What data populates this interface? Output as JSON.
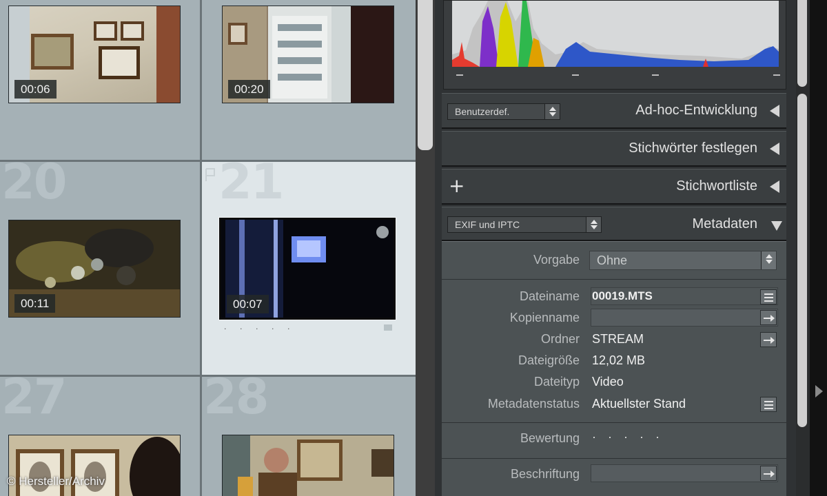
{
  "grid": {
    "cells": [
      {
        "number": "",
        "duration": "00:06"
      },
      {
        "number": "",
        "duration": "00:20"
      },
      {
        "number": "20",
        "duration": "00:11"
      },
      {
        "number": "21",
        "duration": "00:07",
        "selected": true,
        "rating": "· · · · ·"
      },
      {
        "number": "27",
        "duration": ""
      },
      {
        "number": "28",
        "duration": ""
      }
    ]
  },
  "panel": {
    "quick_develop": {
      "preset": "Benutzerdef.",
      "title": "Ad-hoc-Entwicklung"
    },
    "keywording": {
      "title": "Stichwörter festlegen"
    },
    "keyword_list": {
      "add": "+",
      "title": "Stichwortliste"
    },
    "metadata": {
      "view": "EXIF und IPTC",
      "title": "Metadaten",
      "preset_label": "Vorgabe",
      "preset_value": "Ohne",
      "rows": {
        "filename_label": "Dateiname",
        "filename_value": "00019.MTS",
        "copyname_label": "Kopienname",
        "copyname_value": "",
        "folder_label": "Ordner",
        "folder_value": "STREAM",
        "filesize_label": "Dateigröße",
        "filesize_value": "12,02 MB",
        "filetype_label": "Dateityp",
        "filetype_value": "Video",
        "status_label": "Metadatenstatus",
        "status_value": "Aktuellster Stand",
        "rating_label": "Bewertung",
        "rating_value": "· · · · ·",
        "caption_label": "Beschriftung",
        "caption_value": ""
      }
    }
  },
  "colors": {
    "panel_bg": "#2f3234",
    "grid_bg": "#a5b1b6",
    "selected_cell": "#dfe6e9"
  },
  "credit": "© Hersteller/Archiv"
}
